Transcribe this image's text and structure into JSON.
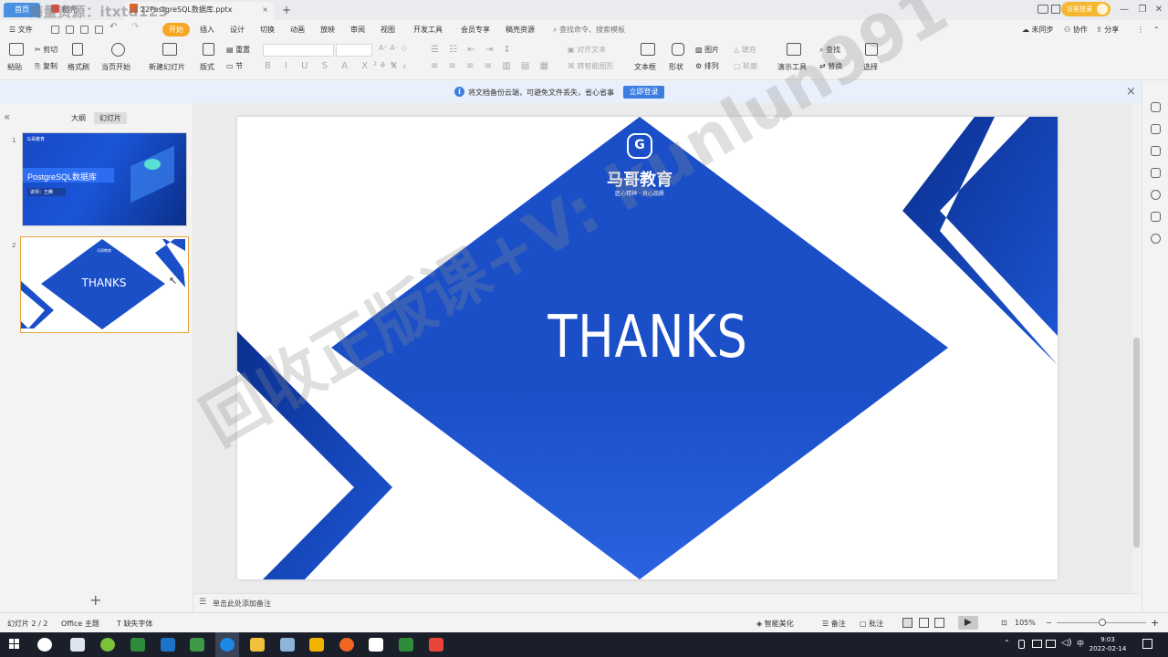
{
  "titlebar": {
    "home_tab": "首页",
    "wps_tab": "稻壳",
    "doc_tab": "22PostgreSQL数据库.pptx",
    "add_tab": "+",
    "overlay_watermark": "海量资源：itxtd123",
    "login_button": "访客登录"
  },
  "menubar": {
    "file": "文件",
    "items": [
      "开始",
      "插入",
      "设计",
      "切换",
      "动画",
      "放映",
      "审阅",
      "视图",
      "开发工具",
      "会员专享",
      "稿壳资源"
    ],
    "search": "查找命令、搜索模板",
    "sync": "未同步",
    "collab": "协作",
    "share": "分享"
  },
  "ribbon": {
    "paste": "粘贴",
    "cut": "剪切",
    "copy": "复制",
    "format_painter": "格式刷",
    "from_current": "当页开始",
    "new_slide": "新建幻灯片",
    "layout": "版式",
    "reset": "重置",
    "section": "节",
    "align_text": "对齐文本",
    "smartart": "转智能图形",
    "textbox": "文本框",
    "shape": "形状",
    "picture": "图片",
    "arrange": "排列",
    "fill": "填充",
    "outline": "轮廓",
    "presenter_tools": "演示工具",
    "find": "查找",
    "replace": "替换",
    "select": "选择"
  },
  "notification": {
    "text": "将文档备份云端，可避免文件丢失，省心省事",
    "button": "立即登录"
  },
  "left_panel": {
    "tab_outline": "大纲",
    "tab_slides": "幻灯片",
    "slide1_num": "1",
    "slide2_num": "2",
    "thumb1_title": "PostgreSQL数据库",
    "thumb1_sub": "讲师：王腾",
    "thumb1_brand": "马哥教育",
    "thumb2_text": "THANKS",
    "thumb2_brand": "马哥教育"
  },
  "slide": {
    "brand": "马哥教育",
    "tagline": "匠心精神 · 良心品质",
    "main_text": "THANKS",
    "logo_glyph": "G"
  },
  "watermark": "回收正版课+V: kunlun991",
  "notes_placeholder": "单击此处添加备注",
  "statusbar": {
    "slide_count": "幻灯片 2 / 2",
    "theme": "Office 主题",
    "missing_font": "缺失字体",
    "beautify": "智能美化",
    "notes": "备注",
    "comments": "批注",
    "zoom": "105%"
  },
  "taskbar": {
    "time": "9:03",
    "date": "2022-02-14",
    "ime": "中"
  },
  "colors": {
    "brand_blue": "#1a4fc8",
    "accent_orange": "#f5a623",
    "notify_blue": "#3b7de0"
  }
}
